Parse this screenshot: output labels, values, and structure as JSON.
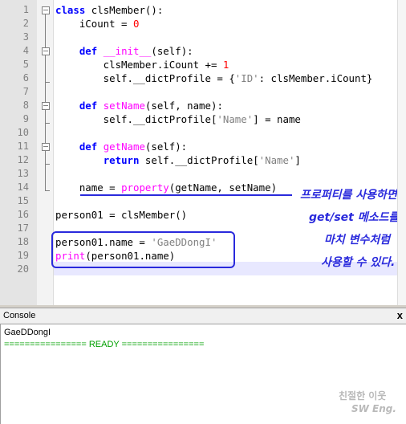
{
  "editor": {
    "line_numbers": [
      "1",
      "2",
      "3",
      "4",
      "5",
      "6",
      "7",
      "8",
      "9",
      "10",
      "11",
      "12",
      "13",
      "14",
      "15",
      "16",
      "17",
      "18",
      "19",
      "20"
    ],
    "lines": [
      {
        "tokens": [
          {
            "c": "kw",
            "t": "class"
          },
          {
            "t": " clsMember():"
          }
        ]
      },
      {
        "tokens": [
          {
            "t": "    iCount = "
          },
          {
            "c": "num",
            "t": "0"
          }
        ]
      },
      {
        "tokens": []
      },
      {
        "tokens": [
          {
            "t": "    "
          },
          {
            "c": "kw",
            "t": "def"
          },
          {
            "t": " "
          },
          {
            "c": "fn",
            "t": "__init__"
          },
          {
            "t": "(self):"
          }
        ]
      },
      {
        "tokens": [
          {
            "t": "        clsMember.iCount += "
          },
          {
            "c": "num",
            "t": "1"
          }
        ]
      },
      {
        "tokens": [
          {
            "t": "        self.__dictProfile = {"
          },
          {
            "c": "str",
            "t": "'ID'"
          },
          {
            "t": ": clsMember.iCount}"
          }
        ]
      },
      {
        "tokens": []
      },
      {
        "tokens": [
          {
            "t": "    "
          },
          {
            "c": "kw",
            "t": "def"
          },
          {
            "t": " "
          },
          {
            "c": "fn",
            "t": "setName"
          },
          {
            "t": "(self, name):"
          }
        ]
      },
      {
        "tokens": [
          {
            "t": "        self.__dictProfile["
          },
          {
            "c": "str",
            "t": "'Name'"
          },
          {
            "t": "] = name"
          }
        ]
      },
      {
        "tokens": []
      },
      {
        "tokens": [
          {
            "t": "    "
          },
          {
            "c": "kw",
            "t": "def"
          },
          {
            "t": " "
          },
          {
            "c": "fn",
            "t": "getName"
          },
          {
            "t": "(self):"
          }
        ]
      },
      {
        "tokens": [
          {
            "t": "        "
          },
          {
            "c": "kw",
            "t": "return"
          },
          {
            "t": " self.__dictProfile["
          },
          {
            "c": "str",
            "t": "'Name'"
          },
          {
            "t": "]"
          }
        ]
      },
      {
        "tokens": []
      },
      {
        "tokens": [
          {
            "t": "    name = "
          },
          {
            "c": "fn",
            "t": "property"
          },
          {
            "t": "(getName, setName)"
          }
        ]
      },
      {
        "tokens": []
      },
      {
        "tokens": [
          {
            "t": "person01 = clsMember()"
          }
        ]
      },
      {
        "tokens": []
      },
      {
        "tokens": [
          {
            "t": "person01.name = "
          },
          {
            "c": "str",
            "t": "'GaeDDongI'"
          }
        ]
      },
      {
        "tokens": [
          {
            "c": "fn",
            "t": "print"
          },
          {
            "t": "(person01.name)"
          }
        ]
      },
      {
        "tokens": []
      }
    ]
  },
  "annotation": {
    "lines": [
      "프로퍼티를 사용하면",
      "get/set 메소드를",
      "마치 변수처럼",
      "사용할 수 있다."
    ]
  },
  "console": {
    "title": "Console",
    "close": "x",
    "output": "GaeDDongI",
    "status": "================ READY ================",
    "status_color": "#00a000"
  },
  "watermark": {
    "line1": "친절한 이웃",
    "line2": "SW Eng."
  }
}
